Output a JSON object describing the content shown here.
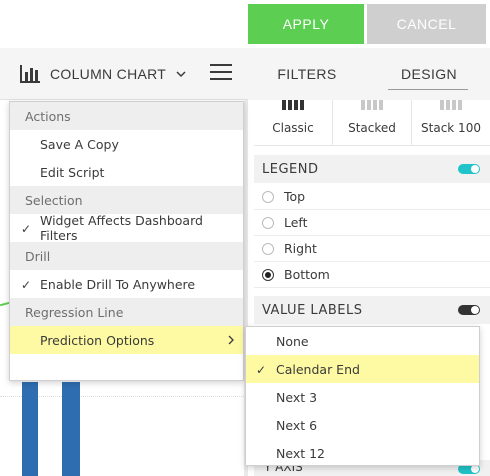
{
  "header": {
    "apply_label": "APPLY",
    "cancel_label": "CANCEL",
    "apply_color": "#5ccf52",
    "cancel_color": "#cfcfcf"
  },
  "toolbar": {
    "chart_type_icon": "column-chart-icon",
    "chart_type_label": "COLUMN CHART",
    "menu_icon": "hamburger-menu-icon"
  },
  "tabs": {
    "filters_label": "FILTERS",
    "design_label": "DESIGN",
    "active": "design"
  },
  "design_panel": {
    "styles": [
      {
        "label": "Classic",
        "icon": "classic-column-icon"
      },
      {
        "label": "Stacked",
        "icon": "stacked-column-icon"
      },
      {
        "label": "Stack 100",
        "icon": "stack100-column-icon"
      }
    ],
    "legend": {
      "title": "LEGEND",
      "enabled": true,
      "options": [
        {
          "label": "Top",
          "selected": false
        },
        {
          "label": "Left",
          "selected": false
        },
        {
          "label": "Right",
          "selected": false
        },
        {
          "label": "Bottom",
          "selected": true
        }
      ]
    },
    "value_labels": {
      "title": "VALUE LABELS",
      "enabled": false
    },
    "axis_partial_label": "Y AXIS",
    "toggle_on_color": "#20c3c7"
  },
  "actions_menu": {
    "sections": [
      {
        "title": "Actions",
        "items": [
          {
            "label": "Save A Copy",
            "checked": false
          },
          {
            "label": "Edit Script",
            "checked": false
          }
        ]
      },
      {
        "title": "Selection",
        "items": [
          {
            "label": "Widget Affects Dashboard Filters",
            "checked": true
          }
        ]
      },
      {
        "title": "Drill",
        "items": [
          {
            "label": "Enable Drill To Anywhere",
            "checked": true
          }
        ]
      },
      {
        "title": "Regression Line",
        "items": [
          {
            "label": "Prediction Options",
            "checked": false,
            "has_submenu": true,
            "highlighted": true
          }
        ]
      }
    ],
    "highlight_color": "#fdfaa3"
  },
  "prediction_submenu": {
    "items": [
      {
        "label": "None",
        "checked": false
      },
      {
        "label": "Calendar End",
        "checked": true
      },
      {
        "label": "Next 3",
        "checked": false
      },
      {
        "label": "Next 6",
        "checked": false
      },
      {
        "label": "Next 12",
        "checked": false
      }
    ]
  },
  "chart_preview": {
    "bar_color": "#2e6db0"
  }
}
